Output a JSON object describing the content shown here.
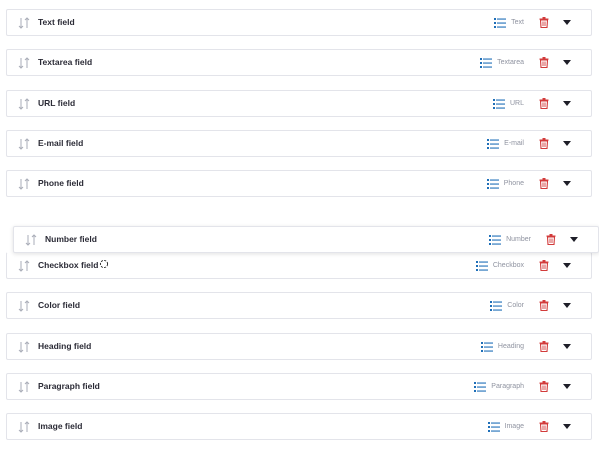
{
  "colors": {
    "accent": "#1f6fb8",
    "delete": "#d23b3b",
    "border": "#e3e4ea"
  },
  "icons": {
    "handle": "sort-arrows-icon",
    "type": "list-icon",
    "delete": "trash-icon",
    "toggle": "caret-down-icon",
    "pointer": "busy-cursor-icon"
  },
  "fields": [
    {
      "label": "Text field",
      "type": "Text"
    },
    {
      "label": "Textarea field",
      "type": "Textarea"
    },
    {
      "label": "URL field",
      "type": "URL"
    },
    {
      "label": "E-mail field",
      "type": "E-mail"
    },
    {
      "label": "Phone field",
      "type": "Phone"
    },
    {
      "label": "Checkbox field",
      "type": "Checkbox"
    },
    {
      "label": "Color field",
      "type": "Color"
    },
    {
      "label": "Heading field",
      "type": "Heading"
    },
    {
      "label": "Paragraph field",
      "type": "Paragraph"
    },
    {
      "label": "Image field",
      "type": "Image"
    }
  ],
  "dragging_field": {
    "label": "Number field",
    "type": "Number"
  }
}
